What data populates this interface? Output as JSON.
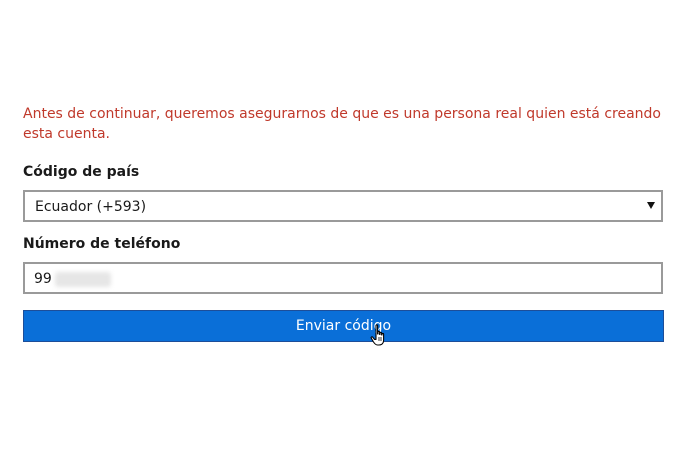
{
  "form": {
    "warning": "Antes de continuar, queremos asegurarnos de que es una persona real quien está creando esta cuenta.",
    "country_label": "Código de país",
    "country_value": "Ecuador (+593)",
    "phone_label": "Número de teléfono",
    "phone_value": "99",
    "send_label": "Enviar código"
  },
  "icons": {
    "dropdown": "chevron-down-icon",
    "cursor": "hand-pointer-icon"
  },
  "colors": {
    "warning_text": "#c0392b",
    "button_bg": "#0a6fd8",
    "button_text": "#ffffff",
    "input_border": "#9a9a9a"
  }
}
